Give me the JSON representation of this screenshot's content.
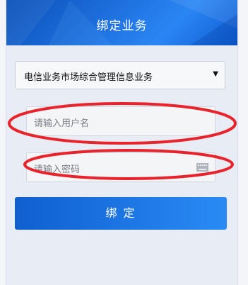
{
  "header": {
    "title": "绑定业务"
  },
  "business_select": {
    "selected": "电信业务市场综合管理信息业务"
  },
  "username": {
    "placeholder": "请输入用户名"
  },
  "password": {
    "placeholder": "请输入密码"
  },
  "bind_button": {
    "label": "绑 定"
  },
  "colors": {
    "accent": "#1f72e0",
    "annotation": "#e8232b"
  },
  "icons": {
    "select_arrow": "caret-down-icon",
    "keyboard": "keyboard-icon"
  }
}
